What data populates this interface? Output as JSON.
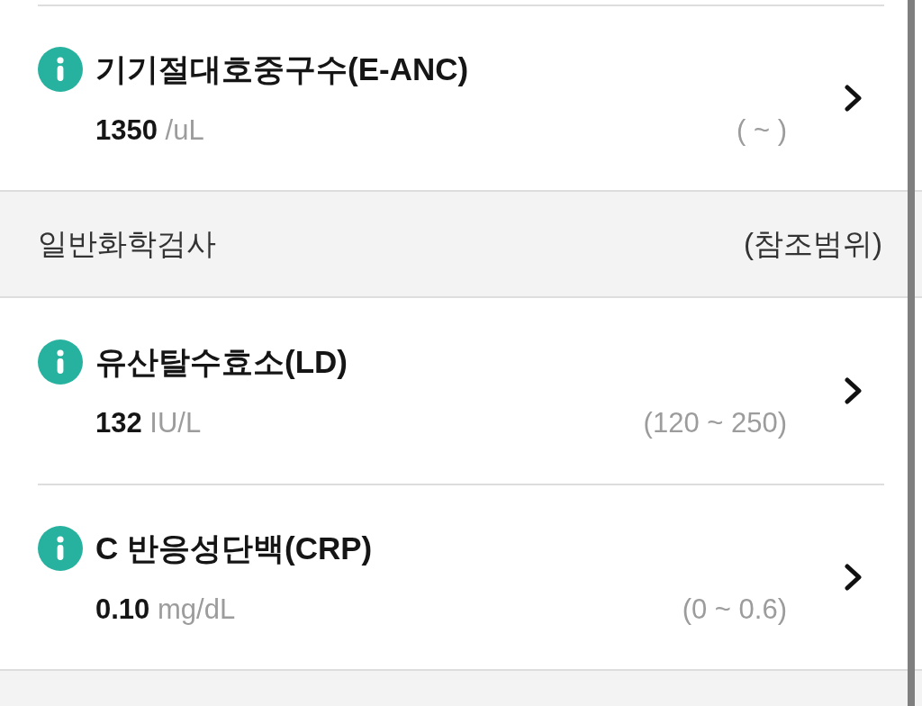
{
  "rows": [
    {
      "kind": "test",
      "name": "기기절대호중구수(E-ANC)",
      "value": "1350",
      "unit": "/uL",
      "range": "( ~ )"
    },
    {
      "kind": "section",
      "title": "일반화학검사",
      "range_label": "(참조범위)"
    },
    {
      "kind": "test",
      "name": "유산탈수효소(LD)",
      "value": "132",
      "unit": "IU/L",
      "range": "(120 ~ 250)"
    },
    {
      "kind": "test",
      "name": "C 반응성단백(CRP)",
      "value": "0.10",
      "unit": "mg/dL",
      "range": "(0 ~ 0.6)"
    }
  ]
}
